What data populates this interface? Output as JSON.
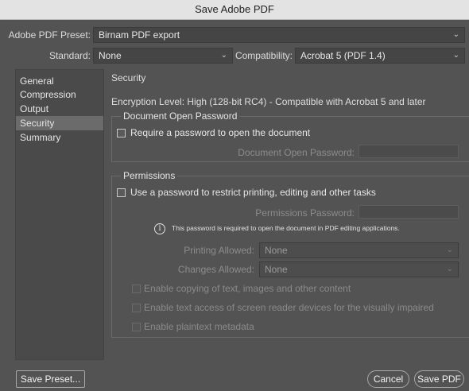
{
  "window": {
    "title": "Save Adobe PDF"
  },
  "preset": {
    "label": "Adobe PDF Preset:",
    "value": "Birnam PDF export"
  },
  "standard": {
    "label": "Standard:",
    "value": "None"
  },
  "compatibility": {
    "label": "Compatibility:",
    "value": "Acrobat 5 (PDF 1.4)"
  },
  "sidebar": {
    "items": [
      {
        "label": "General"
      },
      {
        "label": "Compression"
      },
      {
        "label": "Output"
      },
      {
        "label": "Security"
      },
      {
        "label": "Summary"
      }
    ]
  },
  "security": {
    "title": "Security",
    "encryption": "Encryption Level: High (128-bit RC4) - Compatible with Acrobat 5 and later",
    "open_password": {
      "group_title": "Document Open Password",
      "checkbox_label": "Require a password to open the document",
      "checked": false,
      "field_label": "Document Open Password:",
      "value": ""
    },
    "permissions": {
      "group_title": "Permissions",
      "checkbox_label": "Use a password to restrict printing, editing and other tasks",
      "checked": false,
      "field_label": "Permissions Password:",
      "value": "",
      "info": "This password is required to open the document in PDF editing applications.",
      "printing_label": "Printing Allowed:",
      "printing_value": "None",
      "changes_label": "Changes Allowed:",
      "changes_value": "None",
      "options": [
        {
          "label": "Enable copying of text, images and other content",
          "checked": false
        },
        {
          "label": "Enable text access of screen reader devices for the visually impaired",
          "checked": false
        },
        {
          "label": "Enable plaintext metadata",
          "checked": false
        }
      ]
    }
  },
  "footer": {
    "save_preset": "Save Preset...",
    "cancel": "Cancel",
    "save_pdf": "Save PDF"
  },
  "icons": {
    "dropdown": "chevron-down-icon",
    "info": "info-icon"
  }
}
